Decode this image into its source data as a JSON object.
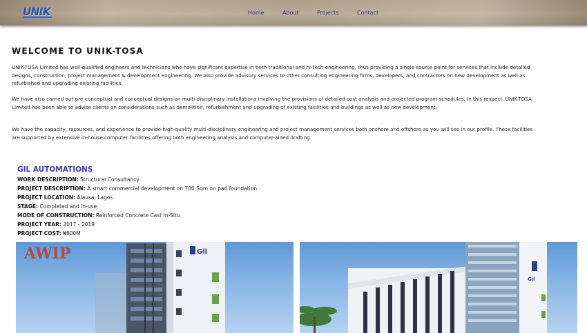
{
  "header": {
    "logo_text": "UNIK",
    "nav": [
      "Home",
      "About",
      "Projects",
      "Contact"
    ]
  },
  "welcome": {
    "title": "WELCOME TO UNIK-TOSA",
    "paragraphs": [
      "UNIK-TOSA Limited has well-qualified engineers and technicians who have significant expertise in both traditional and hi-tech engineering, thus providing a single source point for services that include detailed designs, construction, project management & development engineering. We also provide advisory services to other consulting engineering firms, developers, and contractors on new development as well as refurbished and upgrading existing facilities.",
      "We have also carried out pre-conceptual and conceptual designs on multi-disciplinary installations involving the provisions of detailed cost analysis and projected program schedules. In this respect, UNIK-TOSA Limited has been able to advise clients on considerations such as demolition, refurbishment and upgrading of existing facilities and buildings as well as new development.",
      "We have the capacity, resources, and experience to provide high-quality multi-disciplinary engineering and project management services both onshore and offshore as you will see in our profile. These facilities are supported by extensive in-house computer facilities offering both engineering analysis and computer-aided drafting."
    ]
  },
  "project": {
    "title": "GIL AUTOMATIONS",
    "details": [
      {
        "label": "WORK DESCRIPTION:",
        "value": "Structural Consultancy"
      },
      {
        "label": "PROJECT DESCRIPTION:",
        "value": "A smart commercial development on 700 Sqm on pad foundation"
      },
      {
        "label": "PROJECT LOCATION:",
        "value": "Alausa, Lagos"
      },
      {
        "label": "STAGE:",
        "value": "Completed and In-use"
      },
      {
        "label": "MODE OF CONSTRUCTION:",
        "value": "Reinforced Concrete Cast In-Situ"
      },
      {
        "label": "PROJECT YEAR:",
        "value": "2017 - 2019"
      },
      {
        "label": "PROJECT COST:",
        "value": "₦800M"
      }
    ],
    "images": [
      {
        "watermark": "AWIP",
        "sign": "Gil"
      },
      {
        "sign": "Gil"
      }
    ]
  },
  "colors": {
    "accent": "#3b3ba0",
    "nav_text": "#3a3d8c",
    "logo": "#2156b8",
    "header_bg": "#b3a491"
  },
  "icons": [
    "building-render-image"
  ]
}
